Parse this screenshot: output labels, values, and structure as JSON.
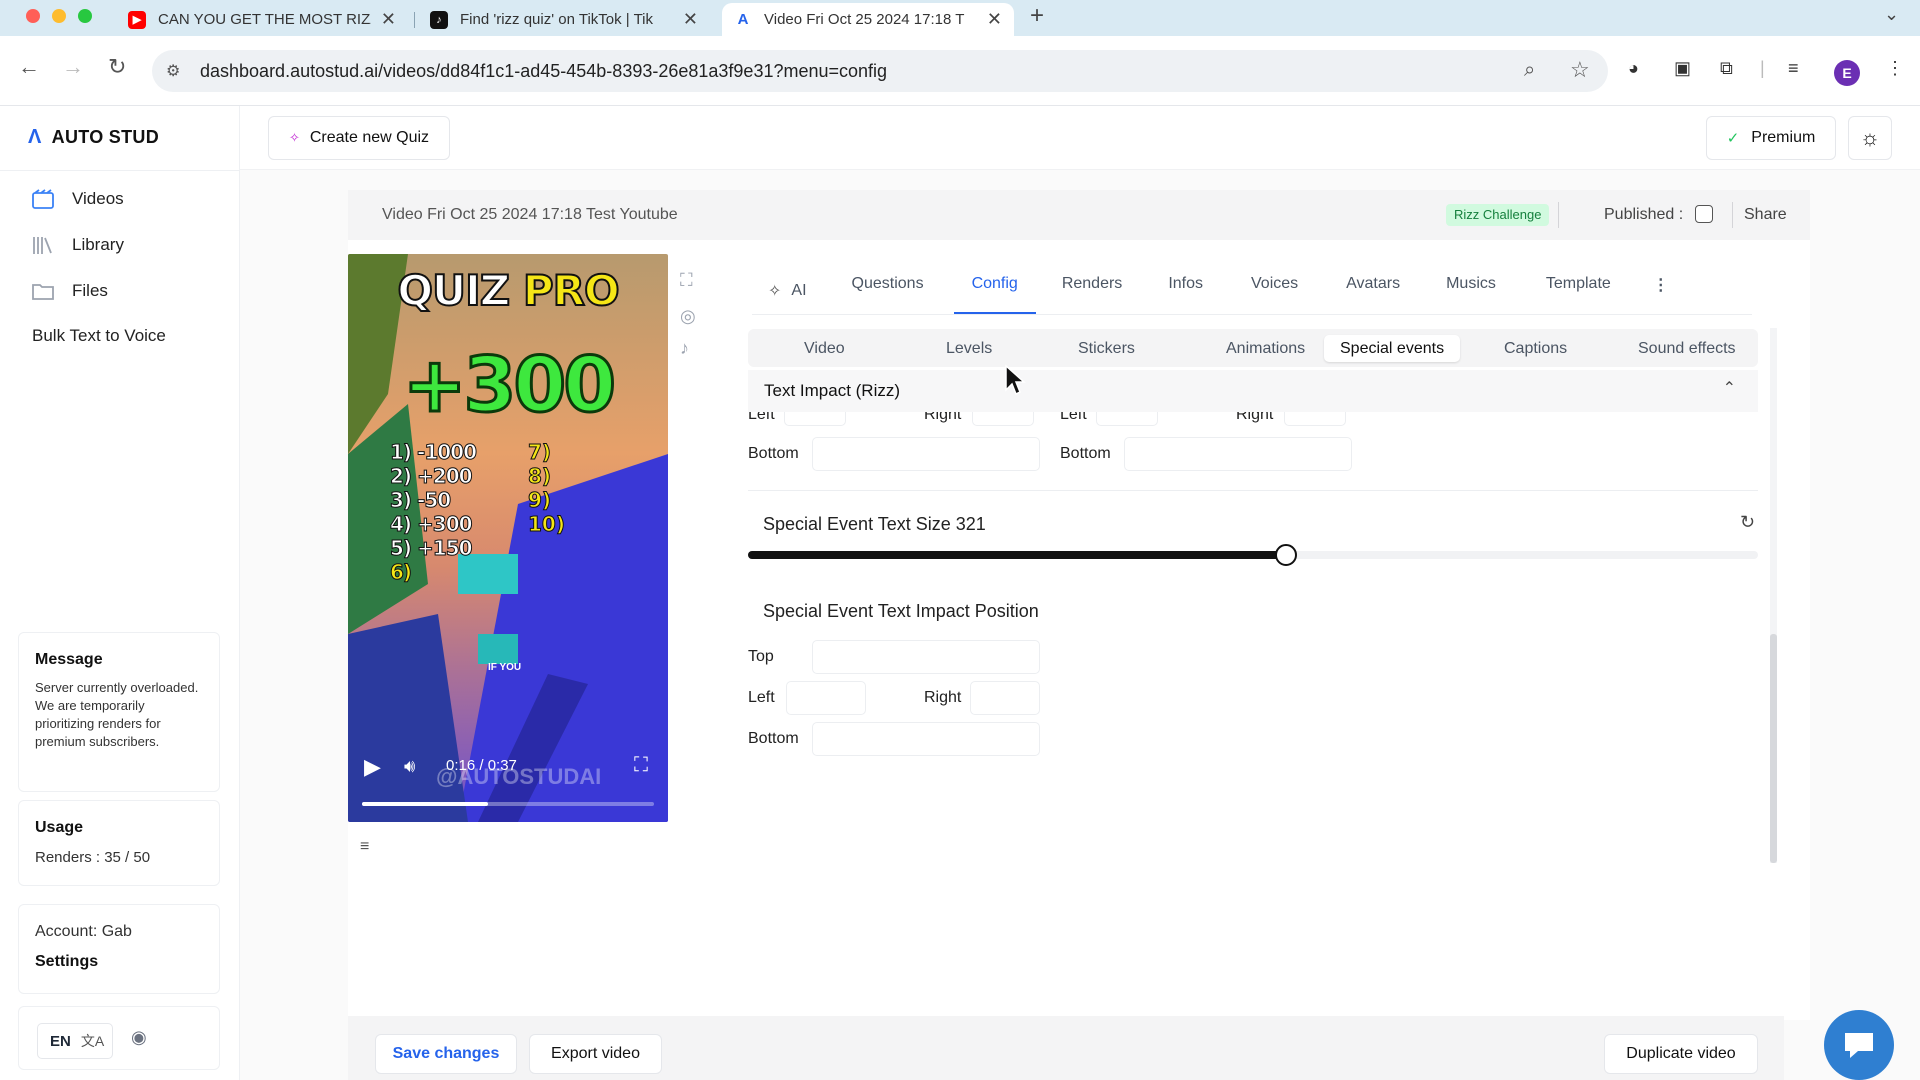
{
  "browser": {
    "tabs": [
      {
        "title": "CAN YOU GET THE MOST RIZZ",
        "favicon": "youtube-icon"
      },
      {
        "title": "Find 'rizz quiz' on TikTok | Tik",
        "favicon": "tiktok-icon"
      },
      {
        "title": "Video Fri Oct 25 2024 17:18 T",
        "favicon": "autostud-icon"
      }
    ],
    "url": "dashboard.autostud.ai/videos/dd84f1c1-ad45-454b-8393-26e81a3f9e31?menu=config",
    "profile_initial": "E"
  },
  "sidebar": {
    "brand": "AUTO STUD",
    "items": [
      {
        "label": "Videos",
        "icon": "videos-icon"
      },
      {
        "label": "Library",
        "icon": "library-icon"
      },
      {
        "label": "Files",
        "icon": "folder-icon"
      },
      {
        "label": "Bulk Text to Voice"
      }
    ],
    "message": {
      "title": "Message",
      "body": "Server currently overloaded. We are temporarily prioritizing renders for premium subscribers."
    },
    "usage": {
      "title": "Usage",
      "renders": "Renders : 35 / 50"
    },
    "account": {
      "name": "Account: Gab",
      "settings": "Settings"
    },
    "language": "EN"
  },
  "header": {
    "create_quiz": "Create new Quiz",
    "premium": "Premium"
  },
  "video_bar": {
    "title": "Video Fri Oct 25 2024 17:18 Test Youtube",
    "badge": "Rizz Challenge",
    "published_label": "Published :",
    "published": false,
    "share": "Share"
  },
  "preview": {
    "title_left": "QUIZ",
    "title_right": "PRO",
    "score": "+300",
    "answers_left": [
      "1) -1000",
      "2) +200",
      "3) -50",
      "4) +300",
      "5) +150",
      "6)"
    ],
    "answers_right": [
      "7)",
      "8)",
      "9)",
      "10)"
    ],
    "caption": "IF YOU",
    "watermark": "@AUTOSTUDAI",
    "time": "0:16 / 0:37",
    "progress": 0.43
  },
  "tabs": [
    "AI",
    "Questions",
    "Config",
    "Renders",
    "Infos",
    "Voices",
    "Avatars",
    "Musics",
    "Template"
  ],
  "active_tab": "Config",
  "subtabs": [
    "Video",
    "Levels",
    "Stickers",
    "Animations",
    "Special events",
    "Captions",
    "Sound effects"
  ],
  "active_subtab": "Special events",
  "config": {
    "section_title": "Text Impact (Rizz)",
    "partial_labels": {
      "left": "Left",
      "right": "Right",
      "bottom": "Bottom"
    },
    "size_label": "Special Event Text Size 321",
    "size_value": 321,
    "size_fraction": 0.533,
    "position_title": "Special Event Text Impact Position",
    "position_labels": {
      "top": "Top",
      "left": "Left",
      "right": "Right",
      "bottom": "Bottom"
    }
  },
  "footer": {
    "save": "Save changes",
    "export": "Export video",
    "duplicate": "Duplicate video"
  }
}
